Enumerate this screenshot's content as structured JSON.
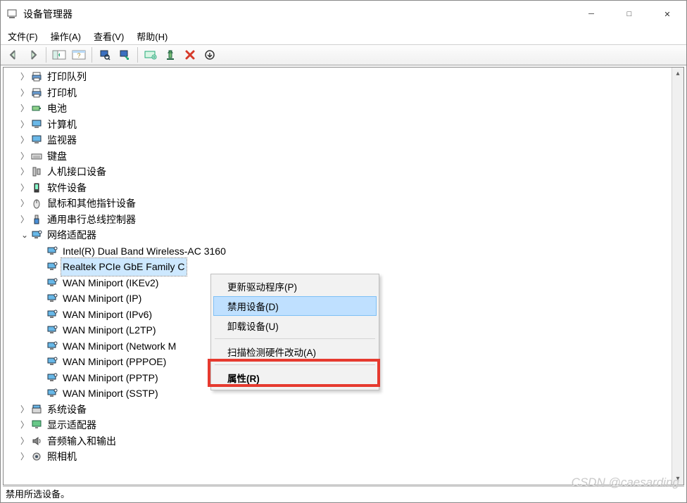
{
  "window": {
    "title": "设备管理器"
  },
  "menubar": [
    "文件(F)",
    "操作(A)",
    "查看(V)",
    "帮助(H)"
  ],
  "tree": [
    {
      "label": "打印队列",
      "icon": "printer",
      "indent": 1,
      "exp": "closed"
    },
    {
      "label": "打印机",
      "icon": "printer",
      "indent": 1,
      "exp": "closed"
    },
    {
      "label": "电池",
      "icon": "battery",
      "indent": 1,
      "exp": "closed"
    },
    {
      "label": "计算机",
      "icon": "monitor",
      "indent": 1,
      "exp": "closed"
    },
    {
      "label": "监视器",
      "icon": "monitor",
      "indent": 1,
      "exp": "closed"
    },
    {
      "label": "键盘",
      "icon": "keyboard",
      "indent": 1,
      "exp": "closed"
    },
    {
      "label": "人机接口设备",
      "icon": "hid",
      "indent": 1,
      "exp": "closed"
    },
    {
      "label": "软件设备",
      "icon": "software",
      "indent": 1,
      "exp": "closed"
    },
    {
      "label": "鼠标和其他指针设备",
      "icon": "mouse",
      "indent": 1,
      "exp": "closed"
    },
    {
      "label": "通用串行总线控制器",
      "icon": "usb",
      "indent": 1,
      "exp": "closed"
    },
    {
      "label": "网络适配器",
      "icon": "network",
      "indent": 1,
      "exp": "open"
    },
    {
      "label": "Intel(R) Dual Band Wireless-AC 3160",
      "icon": "network",
      "indent": 2,
      "exp": "none"
    },
    {
      "label": "Realtek PCIe GbE Family Controller",
      "icon": "network",
      "indent": 2,
      "exp": "none",
      "selected": true,
      "truncate": true
    },
    {
      "label": "WAN Miniport (IKEv2)",
      "icon": "network",
      "indent": 2,
      "exp": "none"
    },
    {
      "label": "WAN Miniport (IP)",
      "icon": "network",
      "indent": 2,
      "exp": "none"
    },
    {
      "label": "WAN Miniport (IPv6)",
      "icon": "network",
      "indent": 2,
      "exp": "none"
    },
    {
      "label": "WAN Miniport (L2TP)",
      "icon": "network",
      "indent": 2,
      "exp": "none"
    },
    {
      "label": "WAN Miniport (Network Monitor)",
      "icon": "network",
      "indent": 2,
      "exp": "none",
      "truncate": true
    },
    {
      "label": "WAN Miniport (PPPOE)",
      "icon": "network",
      "indent": 2,
      "exp": "none"
    },
    {
      "label": "WAN Miniport (PPTP)",
      "icon": "network",
      "indent": 2,
      "exp": "none"
    },
    {
      "label": "WAN Miniport (SSTP)",
      "icon": "network",
      "indent": 2,
      "exp": "none"
    },
    {
      "label": "系统设备",
      "icon": "system",
      "indent": 1,
      "exp": "closed"
    },
    {
      "label": "显示适配器",
      "icon": "display",
      "indent": 1,
      "exp": "closed"
    },
    {
      "label": "音频输入和输出",
      "icon": "audio",
      "indent": 1,
      "exp": "closed"
    },
    {
      "label": "照相机",
      "icon": "camera",
      "indent": 1,
      "exp": "closed"
    }
  ],
  "context_menu": [
    {
      "label": "更新驱动程序(P)",
      "type": "item"
    },
    {
      "label": "禁用设备(D)",
      "type": "item",
      "hovered": true
    },
    {
      "label": "卸载设备(U)",
      "type": "item"
    },
    {
      "type": "sep"
    },
    {
      "label": "扫描检测硬件改动(A)",
      "type": "item"
    },
    {
      "type": "sep"
    },
    {
      "label": "属性(R)",
      "type": "item",
      "bold": true
    }
  ],
  "statusbar": "禁用所选设备。",
  "watermark": "CSDN @caesarding"
}
